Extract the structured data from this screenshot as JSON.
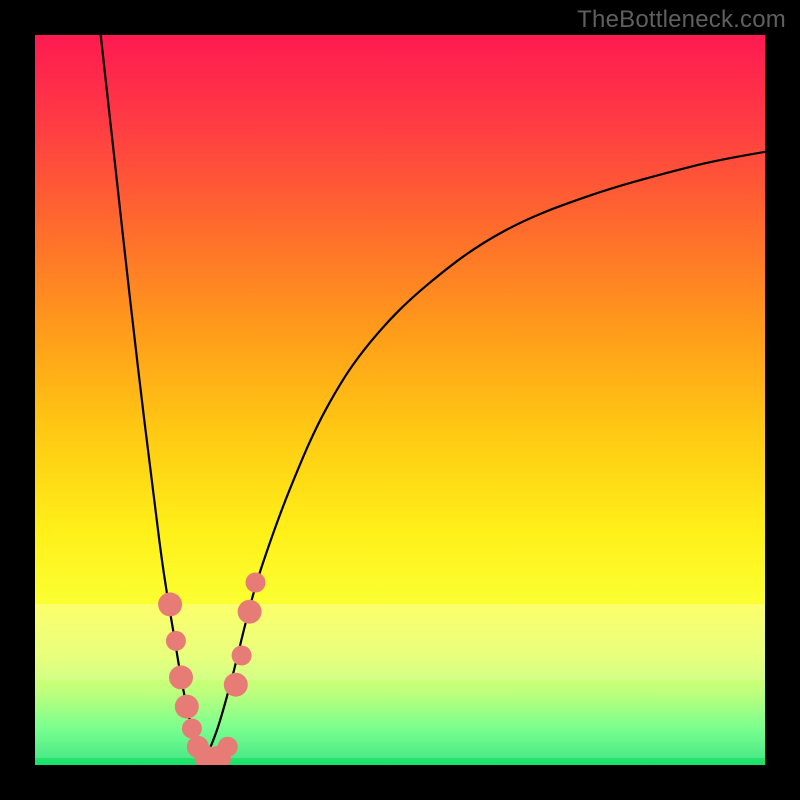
{
  "watermark_text": "TheBottleneck.com",
  "colors": {
    "frame": "#000000",
    "curve": "#000000",
    "marker_fill": "#e77c77",
    "marker_stroke": "#d66a65"
  },
  "chart_data": {
    "type": "line",
    "title": "",
    "xlabel": "",
    "ylabel": "",
    "xlim": [
      0,
      100
    ],
    "ylim": [
      0,
      100
    ],
    "x_min_point": 23,
    "series": [
      {
        "name": "left-branch",
        "x": [
          9,
          11,
          13,
          15,
          17,
          18,
          19,
          20,
          21,
          22,
          23
        ],
        "y": [
          100,
          82,
          64,
          47,
          31,
          24,
          18,
          12,
          7,
          3,
          0
        ]
      },
      {
        "name": "right-branch",
        "x": [
          23,
          25,
          27,
          29,
          31,
          35,
          40,
          46,
          54,
          64,
          76,
          90,
          100
        ],
        "y": [
          0,
          5,
          12,
          20,
          27,
          38,
          49,
          58,
          66,
          73,
          78,
          82,
          84
        ]
      }
    ],
    "markers": [
      {
        "x": 18.5,
        "y": 22,
        "r": 12
      },
      {
        "x": 19.3,
        "y": 17,
        "r": 10
      },
      {
        "x": 20.0,
        "y": 12,
        "r": 12
      },
      {
        "x": 20.8,
        "y": 8,
        "r": 12
      },
      {
        "x": 21.5,
        "y": 5,
        "r": 10
      },
      {
        "x": 22.3,
        "y": 2.5,
        "r": 11
      },
      {
        "x": 23.5,
        "y": 1,
        "r": 12
      },
      {
        "x": 25.2,
        "y": 1,
        "r": 12
      },
      {
        "x": 26.4,
        "y": 2.5,
        "r": 10
      },
      {
        "x": 27.5,
        "y": 11,
        "r": 12
      },
      {
        "x": 28.3,
        "y": 15,
        "r": 10
      },
      {
        "x": 29.4,
        "y": 21,
        "r": 12
      },
      {
        "x": 30.2,
        "y": 25,
        "r": 10
      }
    ],
    "pale_bands_y": [
      22,
      12
    ]
  }
}
